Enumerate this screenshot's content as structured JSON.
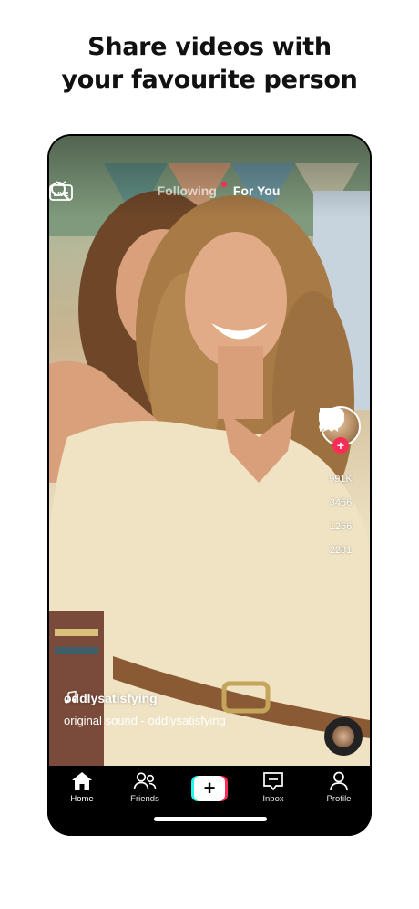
{
  "headline": {
    "line1": "Share videos with",
    "line2": "your favourite person"
  },
  "top_bar": {
    "tab_following": "Following",
    "tab_for_you": "For You"
  },
  "side": {
    "likes": "991K",
    "comments": "3456",
    "saves": "1256",
    "shares": "2281"
  },
  "caption": {
    "username": "oddlysatisfying",
    "sound": "original sound - oddlysatisfying"
  },
  "nav": {
    "home": "Home",
    "friends": "Friends",
    "inbox": "Inbox",
    "profile": "Profile",
    "create": "+"
  },
  "colors": {
    "accent_red": "#fe2c55",
    "accent_cyan": "#25f4ee"
  }
}
